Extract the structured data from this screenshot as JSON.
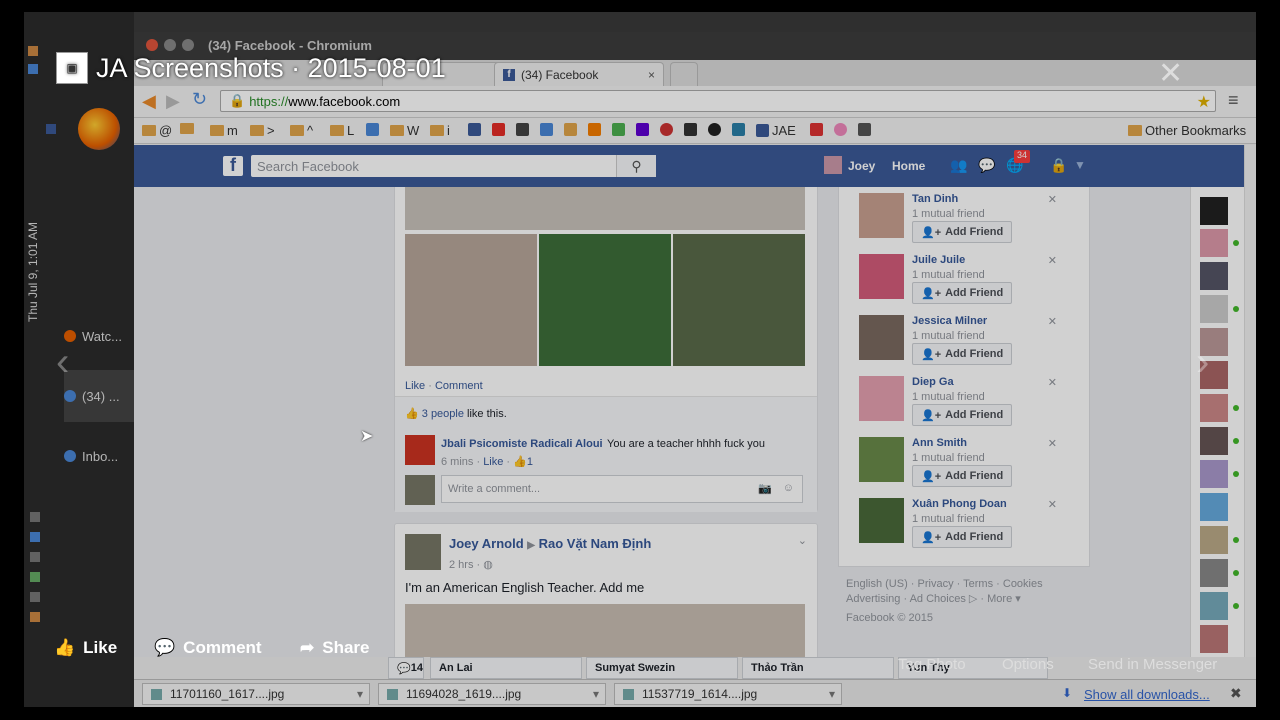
{
  "viewer": {
    "title": "JA Screenshots · 2015-08-01",
    "like_label": "Like",
    "comment_label": "Comment",
    "share_label": "Share",
    "tag_label": "Tag Photo",
    "options_label": "Options",
    "messenger_label": "Send in Messenger",
    "close_icon": "✕"
  },
  "unity": {
    "clock": "Thu Jul 9, 1:01 AM",
    "apps": [
      {
        "label": "Watc..."
      },
      {
        "label": "(34) ..."
      },
      {
        "label": "Inbo..."
      }
    ]
  },
  "browser": {
    "window_title": "(34) Facebook - Chromium",
    "tab_label": "(34) Facebook",
    "url_scheme": "https://",
    "url_rest": "www.facebook.com",
    "bookmarks": [
      "@",
      "m",
      ">",
      "^",
      "L",
      "W",
      "i",
      "JAE"
    ],
    "other_bookmarks": "Other Bookmarks"
  },
  "facebook": {
    "search_placeholder": "Search Facebook",
    "user": "Joey",
    "home": "Home",
    "notifications": "34",
    "post1": {
      "like": "Like",
      "comment": "Comment",
      "likes_count": "3 people",
      "likes_suffix": "like this.",
      "comment_author": "Jbali Psicomiste Radicali Aloui",
      "comment_text": "You are a teacher hhhh fuck you",
      "comment_time": "6 mins",
      "comment_like": "Like",
      "comment_likes": "1",
      "write_placeholder": "Write a comment..."
    },
    "post2": {
      "author": "Joey Arnold",
      "target": "Rao Vặt Nam Định",
      "time": "2 hrs",
      "text": "I'm an American English Teacher. Add me"
    },
    "people": [
      {
        "name": "Tan Dinh",
        "mutual": "1 mutual friend"
      },
      {
        "name": "Juile Juile",
        "mutual": "1 mutual friend"
      },
      {
        "name": "Jessica Milner",
        "mutual": "1 mutual friend"
      },
      {
        "name": "Diep Ga",
        "mutual": "1 mutual friend"
      },
      {
        "name": "Ann Smith",
        "mutual": "1 mutual friend"
      },
      {
        "name": "Xuân Phong Doan",
        "mutual": "1 mutual friend"
      }
    ],
    "add_friend": "Add Friend",
    "footer1": "English (US) · Privacy · Terms · Cookies",
    "footer2": "Advertising · Ad Choices ▷ · More ▾",
    "copyright": "Facebook © 2015",
    "chat_count": "14",
    "chat_tabs": [
      "An Lai",
      "Sumyat Swezin",
      "Thảo Trần",
      "Yun Thy"
    ]
  },
  "downloads": {
    "files": [
      "11701160_1617....jpg",
      "11694028_1619....jpg",
      "11537719_1614....jpg"
    ],
    "show_all": "Show all downloads..."
  },
  "colors": {
    "fb_blue": "#3b5998",
    "link": "#365899",
    "notif": "#fa3e3e"
  }
}
